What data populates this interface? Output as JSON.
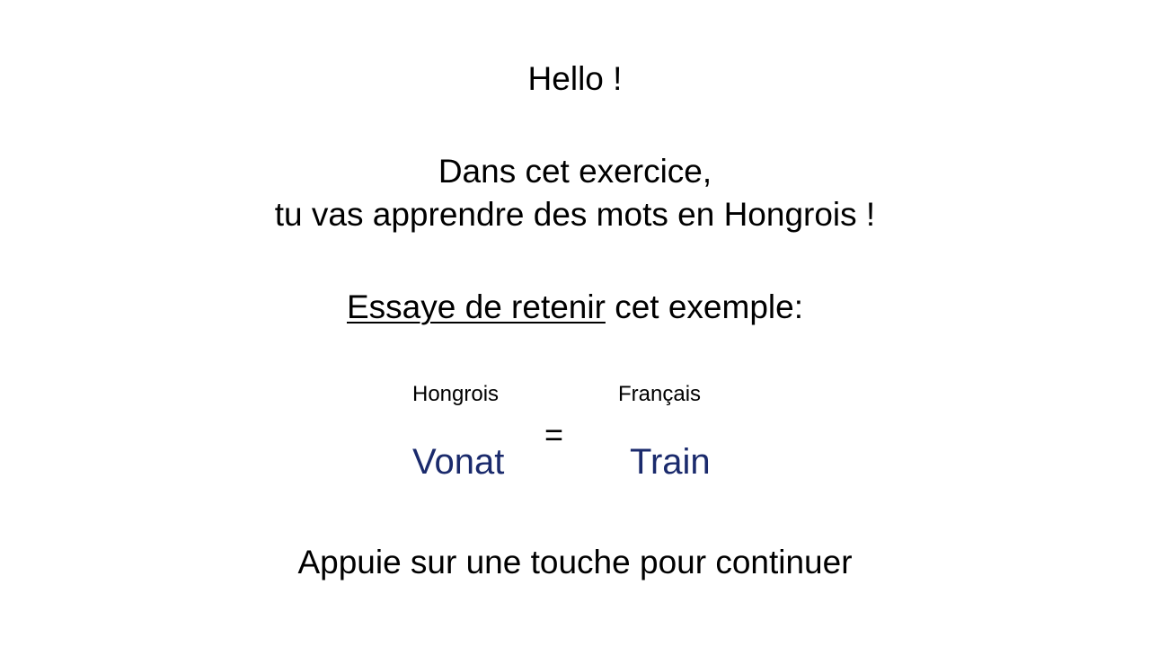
{
  "greeting": "Hello !",
  "intro": {
    "line1": "Dans cet exercice,",
    "line2": "tu vas apprendre des mots en Hongrois !"
  },
  "instruction": {
    "underlined": "Essaye de retenir",
    "rest": " cet exemple:"
  },
  "example": {
    "header_source": "Hongrois",
    "header_target": "Français",
    "word_source": "Vonat",
    "equals": "=",
    "word_target": "Train"
  },
  "continue_prompt": "Appuie sur une touche pour continuer",
  "colors": {
    "text": "#000000",
    "word": "#1a2a6c",
    "background": "#ffffff"
  }
}
